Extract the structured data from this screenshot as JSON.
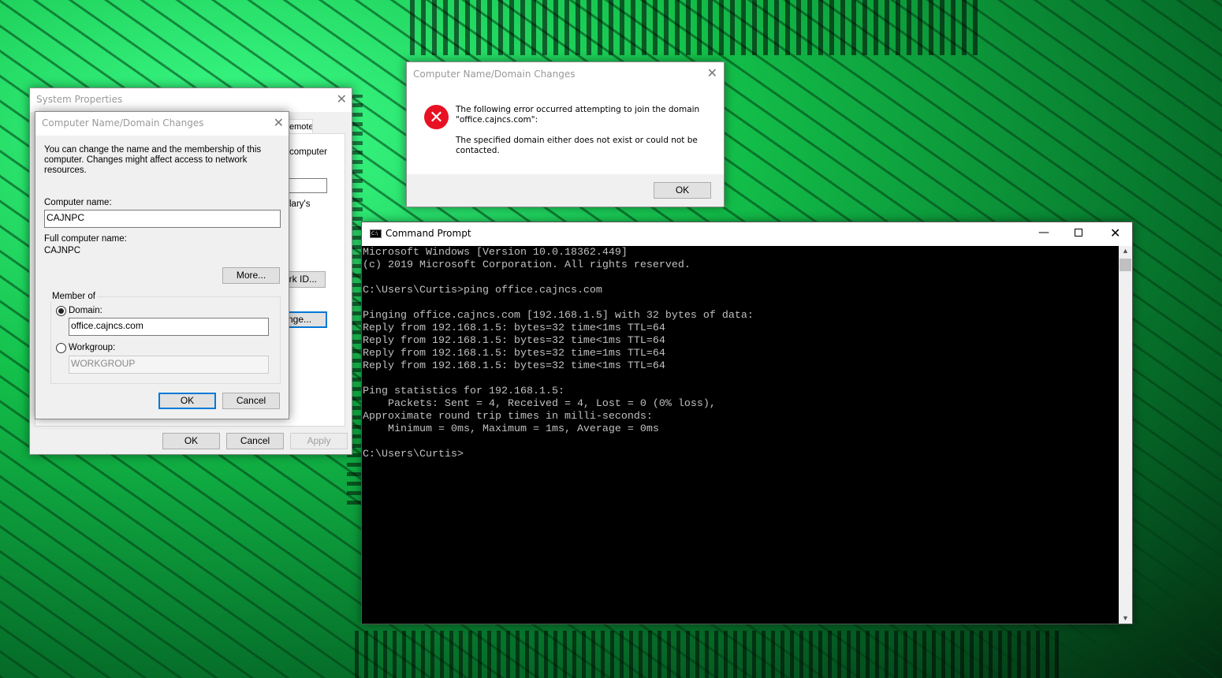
{
  "system_properties": {
    "title": "System Properties",
    "tab_partial": "emote",
    "text_partial_1": "computer",
    "text_partial_2": "lary's",
    "network_id_partial": "rk ID...",
    "change_partial": "nge...",
    "ok": "OK",
    "cancel": "Cancel",
    "apply": "Apply"
  },
  "domain_changes": {
    "title": "Computer Name/Domain Changes",
    "description": "You can change the name and the membership of this computer. Changes might affect access to network resources.",
    "computer_name_label": "Computer name:",
    "computer_name_value": "CAJNPC",
    "full_name_label": "Full computer name:",
    "full_name_value": "CAJNPC",
    "more": "More...",
    "member_of": "Member of",
    "domain_label": "Domain:",
    "domain_value": "office.cajncs.com",
    "workgroup_label": "Workgroup:",
    "workgroup_value": "WORKGROUP",
    "selected": "domain",
    "ok": "OK",
    "cancel": "Cancel"
  },
  "error_dialog": {
    "title": "Computer Name/Domain Changes",
    "line1": "The following error occurred attempting to join the domain \"office.cajncs.com\":",
    "line2": "The specified domain either does not exist or could not be contacted.",
    "ok": "OK",
    "icon": "error-icon",
    "icon_color": "#e81123"
  },
  "cmd": {
    "title": "Command Prompt",
    "output": "Microsoft Windows [Version 10.0.18362.449]\n(c) 2019 Microsoft Corporation. All rights reserved.\n\nC:\\Users\\Curtis>ping office.cajncs.com\n\nPinging office.cajncs.com [192.168.1.5] with 32 bytes of data:\nReply from 192.168.1.5: bytes=32 time<1ms TTL=64\nReply from 192.168.1.5: bytes=32 time<1ms TTL=64\nReply from 192.168.1.5: bytes=32 time=1ms TTL=64\nReply from 192.168.1.5: bytes=32 time<1ms TTL=64\n\nPing statistics for 192.168.1.5:\n    Packets: Sent = 4, Received = 4, Lost = 0 (0% loss),\nApproximate round trip times in milli-seconds:\n    Minimum = 0ms, Maximum = 1ms, Average = 0ms\n\nC:\\Users\\Curtis>"
  }
}
